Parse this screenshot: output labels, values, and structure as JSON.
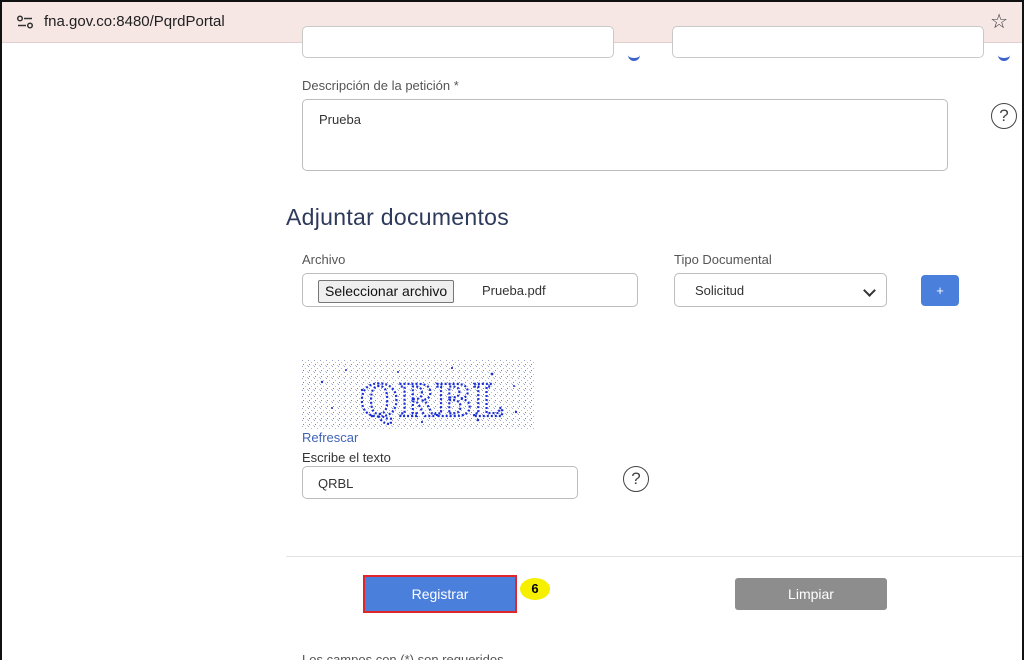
{
  "browser": {
    "url": "fna.gov.co:8480/PqrdPortal",
    "site_icon": "site-settings-icon",
    "bookmark_icon": "star-icon"
  },
  "form": {
    "description": {
      "label": "Descripción de la petición *",
      "value": "Prueba",
      "help": "?"
    },
    "attachments": {
      "title": "Adjuntar documentos",
      "file_label": "Archivo",
      "file_button": "Seleccionar archivo",
      "file_name": "Prueba.pdf",
      "doc_type_label": "Tipo Documental",
      "doc_type_value": "Solicitud",
      "add_button": "+"
    },
    "captcha": {
      "image_text": "QRBL",
      "refresh_link": "Refrescar",
      "input_label": "Escribe el texto",
      "input_value": "QRBL",
      "help": "?"
    },
    "actions": {
      "register": "Registrar",
      "step_badge": "6",
      "clear": "Limpiar"
    },
    "footnote": "Los campos con (*) son requeridos"
  },
  "colors": {
    "primary": "#4a7fdc",
    "highlight_border": "#e0262b",
    "badge": "#f7ef00",
    "secondary": "#8d8d8d",
    "title": "#2e3a5c",
    "link": "#3f63b8"
  }
}
